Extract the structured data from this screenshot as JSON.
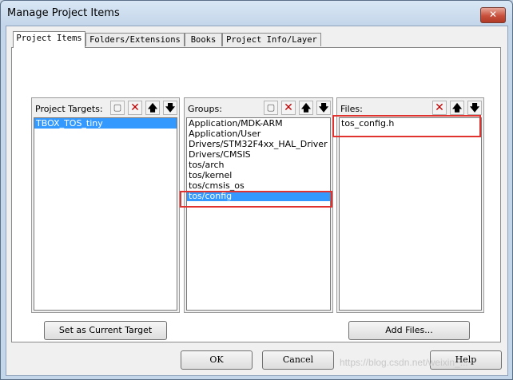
{
  "window": {
    "title": "Manage Project Items",
    "close_glyph": "✕"
  },
  "tabs": [
    {
      "label": "Project Items",
      "active": true
    },
    {
      "label": "Folders/Extensions",
      "active": false
    },
    {
      "label": "Books",
      "active": false
    },
    {
      "label": "Project Info/Layer",
      "active": false
    }
  ],
  "targets": {
    "label": "Project Targets:",
    "items": [
      "TBOX_TOS_tiny"
    ],
    "selected_index": 0,
    "action_button": "Set as Current Target"
  },
  "groups": {
    "label": "Groups:",
    "items": [
      "Application/MDK-ARM",
      "Application/User",
      "Drivers/STM32F4xx_HAL_Driver",
      "Drivers/CMSIS",
      "tos/arch",
      "tos/kernel",
      "tos/cmsis_os",
      "tos/config"
    ],
    "selected_index": 7
  },
  "files": {
    "label": "Files:",
    "items": [
      "tos_config.h"
    ],
    "action_button": "Add Files..."
  },
  "toolbar_icons": {
    "new": "▢",
    "delete": "✕",
    "up": "🡅",
    "down": "🡇"
  },
  "footer": {
    "ok": "OK",
    "cancel": "Cancel",
    "help": "Help"
  },
  "watermark": "https://blog.csdn.net/weixin_..."
}
